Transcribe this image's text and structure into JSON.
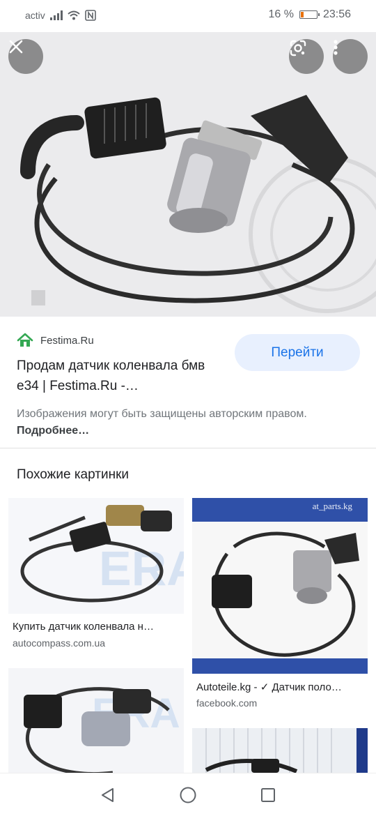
{
  "status_bar": {
    "carrier": "activ",
    "battery": "16 %",
    "time": "23:56"
  },
  "viewer": {
    "close_icon": "close-icon",
    "lens_icon": "google-lens-icon",
    "more_icon": "more-vert-icon"
  },
  "result": {
    "source_name": "Festima.Ru",
    "title": "Продам датчик коленвала бмв е34 | Festima.Ru -…",
    "visit_label": "Перейти",
    "copyright_text": "Изображения могут быть защищены авторским правом.",
    "more_link": "Подробнее…"
  },
  "related": {
    "heading": "Похожие картинки",
    "items": [
      {
        "caption": "Купить датчик коленвала н…",
        "domain": "autocompass.com.ua"
      },
      {
        "caption": "Autoteile.kg - ✓ Датчик поло…",
        "domain": "facebook.com",
        "watermark": "at_parts.kg"
      },
      {
        "caption": "",
        "domain": ""
      },
      {
        "caption": "",
        "domain": ""
      }
    ]
  },
  "colors": {
    "accent": "#1a73e8",
    "visit_bg": "#e8f0fe",
    "house_green": "#34a853",
    "thumb_blue": "#2f50a8"
  }
}
